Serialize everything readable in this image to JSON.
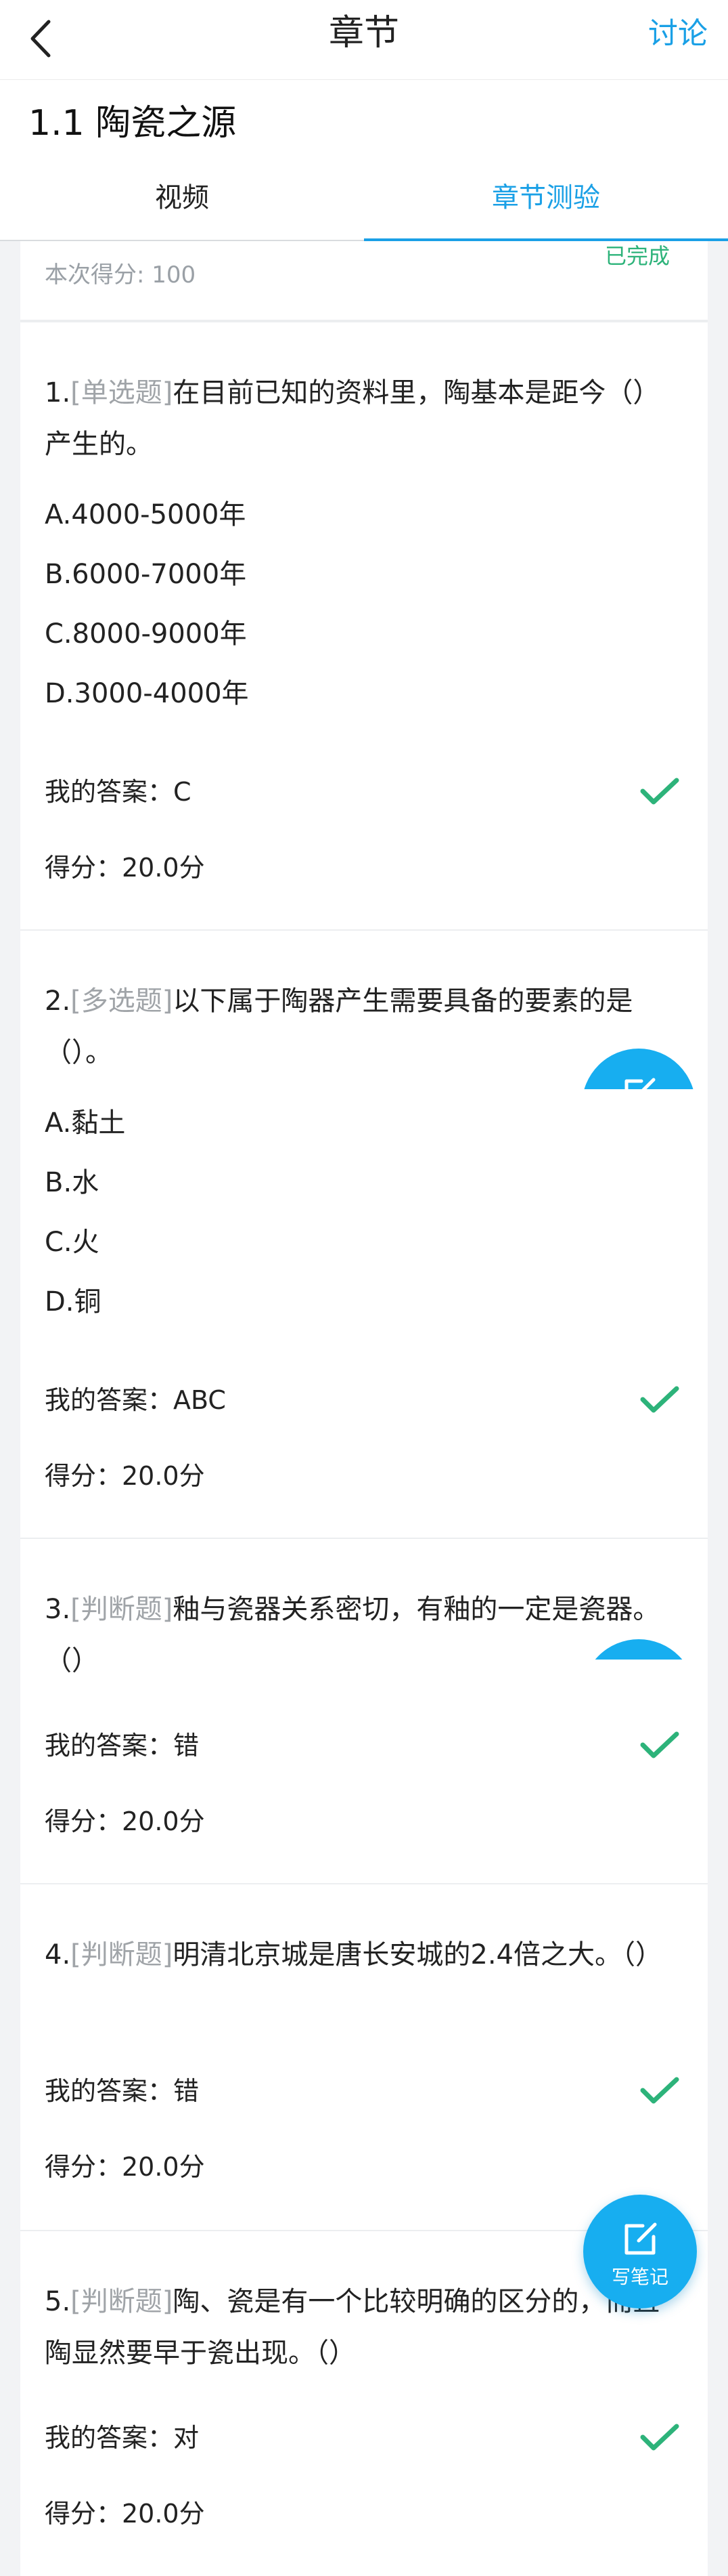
{
  "header": {
    "title": "章节",
    "right_action": "讨论"
  },
  "section": {
    "title": "1.1  陶瓷之源"
  },
  "tabs": [
    {
      "label": "视频",
      "active": false
    },
    {
      "label": "章节测验",
      "active": true
    }
  ],
  "quiz": {
    "score_text": "本次得分: 100",
    "status": "已完成",
    "questions": [
      {
        "number": "1.",
        "type": "[单选题]",
        "text": "在目前已知的资料里，陶基本是距今（）产生的。",
        "options": [
          "A.4000-5000年",
          "B.6000-7000年",
          "C.8000-9000年",
          "D.3000-4000年"
        ],
        "my_answer": "我的答案：C",
        "score": "得分：20.0分",
        "correct": true
      },
      {
        "number": "2.",
        "type": "[多选题]",
        "text": "以下属于陶器产生需要具备的要素的是（）。",
        "options": [
          "A.黏土",
          "B.水",
          "C.火",
          "D.铜"
        ],
        "my_answer": "我的答案：ABC",
        "score": "得分：20.0分",
        "correct": true
      },
      {
        "number": "3.",
        "type": "[判断题]",
        "text": "釉与瓷器关系密切，有釉的一定是瓷器。（）",
        "options": [],
        "my_answer": "我的答案：错",
        "score": "得分：20.0分",
        "correct": true
      },
      {
        "number": "4.",
        "type": "[判断题]",
        "text": "明清北京城是唐长安城的2.4倍之大。（）",
        "options": [],
        "my_answer": "我的答案：错",
        "score": "得分：20.0分",
        "correct": true
      },
      {
        "number": "5.",
        "type": "[判断题]",
        "text": "陶、瓷是有一个比较明确的区分的，而且陶显然要早于瓷出现。（）",
        "options": [],
        "my_answer": "我的答案：对",
        "score": "得分：20.0分",
        "correct": true
      }
    ]
  },
  "fab": {
    "label": "写笔记",
    "icon": "edit-note-icon"
  },
  "colors": {
    "accent": "#1aa0e6",
    "success": "#2db37a",
    "fab": "#17aef0",
    "muted": "#a0a4a8"
  }
}
